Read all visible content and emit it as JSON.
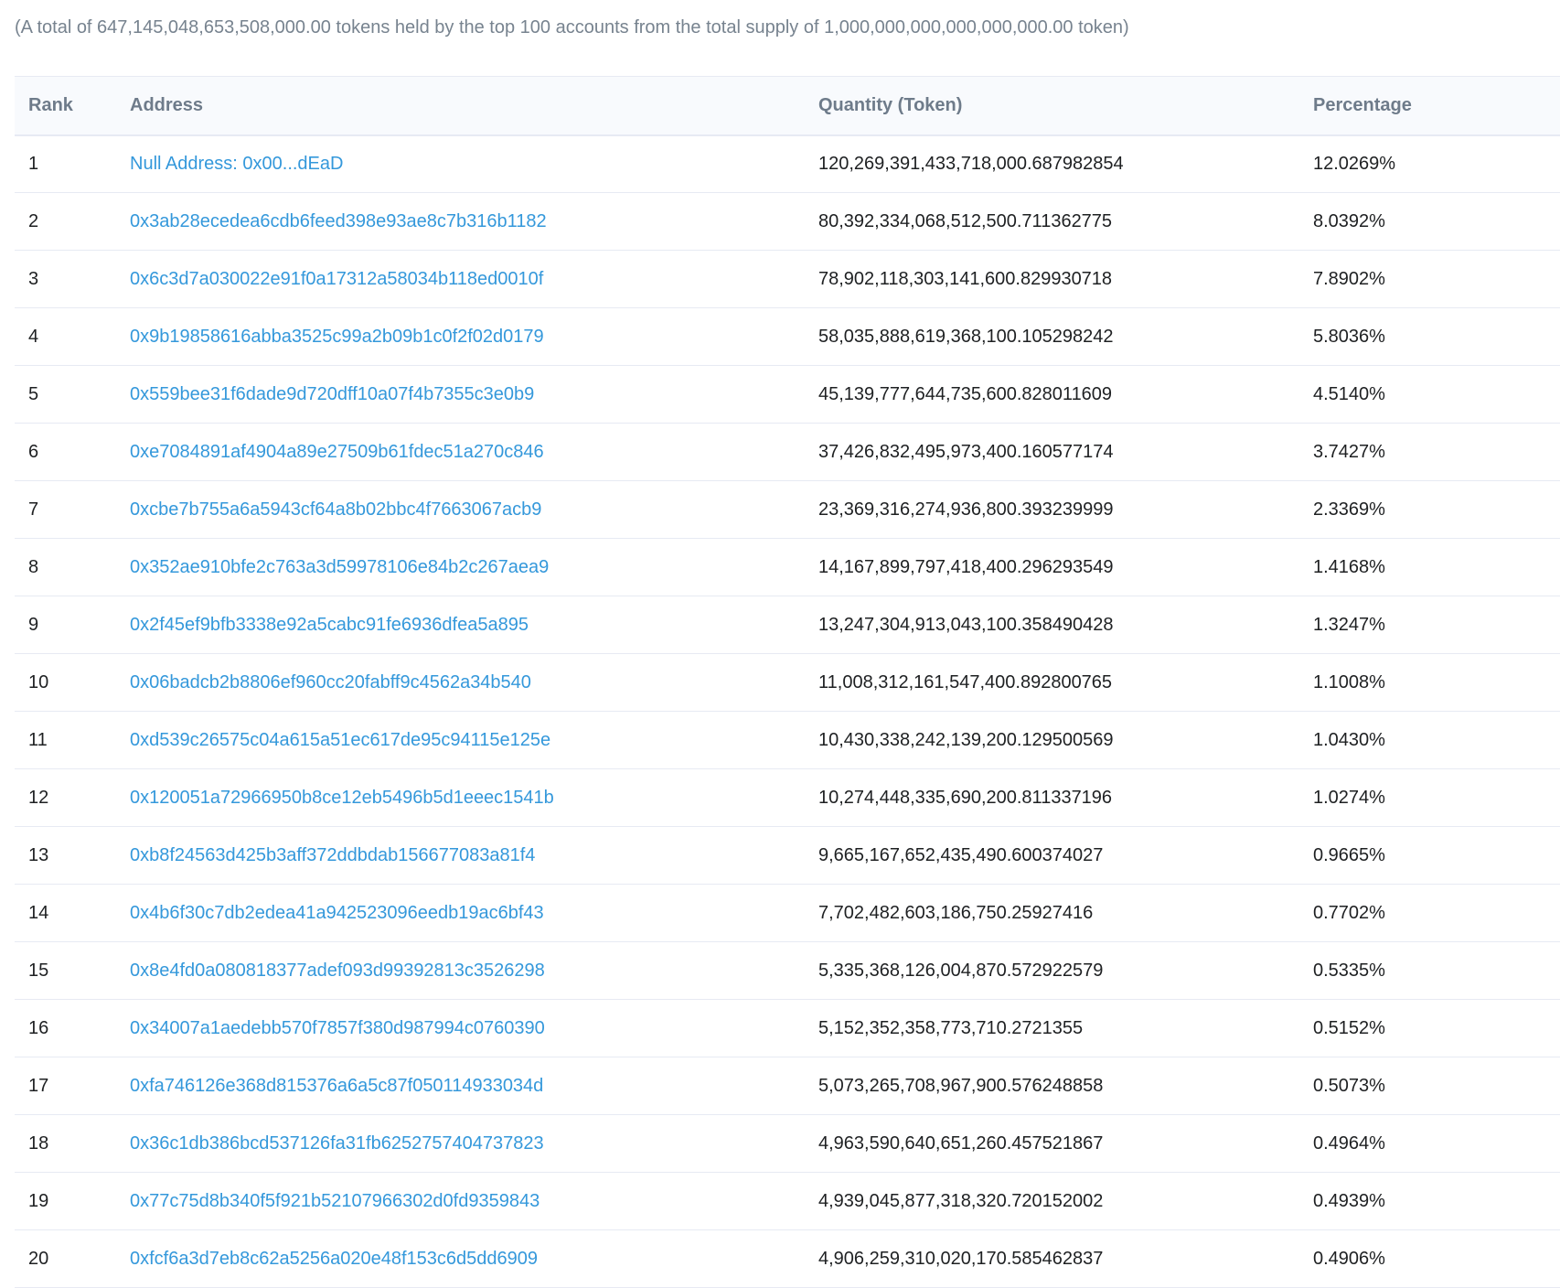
{
  "summary": "(A total of 647,145,048,653,508,000.00 tokens held by the top 100 accounts from the total supply of 1,000,000,000,000,000,000.00 token)",
  "table": {
    "headers": {
      "rank": "Rank",
      "address": "Address",
      "quantity": "Quantity (Token)",
      "percentage": "Percentage"
    },
    "rows": [
      {
        "rank": "1",
        "address": "Null Address: 0x00...dEaD",
        "quantity": "120,269,391,433,718,000.687982854",
        "percentage": "12.0269%"
      },
      {
        "rank": "2",
        "address": "0x3ab28ecedea6cdb6feed398e93ae8c7b316b1182",
        "quantity": "80,392,334,068,512,500.711362775",
        "percentage": "8.0392%"
      },
      {
        "rank": "3",
        "address": "0x6c3d7a030022e91f0a17312a58034b118ed0010f",
        "quantity": "78,902,118,303,141,600.829930718",
        "percentage": "7.8902%"
      },
      {
        "rank": "4",
        "address": "0x9b19858616abba3525c99a2b09b1c0f2f02d0179",
        "quantity": "58,035,888,619,368,100.105298242",
        "percentage": "5.8036%"
      },
      {
        "rank": "5",
        "address": "0x559bee31f6dade9d720dff10a07f4b7355c3e0b9",
        "quantity": "45,139,777,644,735,600.828011609",
        "percentage": "4.5140%"
      },
      {
        "rank": "6",
        "address": "0xe7084891af4904a89e27509b61fdec51a270c846",
        "quantity": "37,426,832,495,973,400.160577174",
        "percentage": "3.7427%"
      },
      {
        "rank": "7",
        "address": "0xcbe7b755a6a5943cf64a8b02bbc4f7663067acb9",
        "quantity": "23,369,316,274,936,800.393239999",
        "percentage": "2.3369%"
      },
      {
        "rank": "8",
        "address": "0x352ae910bfe2c763a3d59978106e84b2c267aea9",
        "quantity": "14,167,899,797,418,400.296293549",
        "percentage": "1.4168%"
      },
      {
        "rank": "9",
        "address": "0x2f45ef9bfb3338e92a5cabc91fe6936dfea5a895",
        "quantity": "13,247,304,913,043,100.358490428",
        "percentage": "1.3247%"
      },
      {
        "rank": "10",
        "address": "0x06badcb2b8806ef960cc20fabff9c4562a34b540",
        "quantity": "11,008,312,161,547,400.892800765",
        "percentage": "1.1008%"
      },
      {
        "rank": "11",
        "address": "0xd539c26575c04a615a51ec617de95c94115e125e",
        "quantity": "10,430,338,242,139,200.129500569",
        "percentage": "1.0430%"
      },
      {
        "rank": "12",
        "address": "0x120051a72966950b8ce12eb5496b5d1eeec1541b",
        "quantity": "10,274,448,335,690,200.811337196",
        "percentage": "1.0274%"
      },
      {
        "rank": "13",
        "address": "0xb8f24563d425b3aff372ddbdab156677083a81f4",
        "quantity": "9,665,167,652,435,490.600374027",
        "percentage": "0.9665%"
      },
      {
        "rank": "14",
        "address": "0x4b6f30c7db2edea41a942523096eedb19ac6bf43",
        "quantity": "7,702,482,603,186,750.25927416",
        "percentage": "0.7702%"
      },
      {
        "rank": "15",
        "address": "0x8e4fd0a080818377adef093d99392813c3526298",
        "quantity": "5,335,368,126,004,870.572922579",
        "percentage": "0.5335%"
      },
      {
        "rank": "16",
        "address": "0x34007a1aedebb570f7857f380d987994c0760390",
        "quantity": "5,152,352,358,773,710.2721355",
        "percentage": "0.5152%"
      },
      {
        "rank": "17",
        "address": "0xfa746126e368d815376a6a5c87f050114933034d",
        "quantity": "5,073,265,708,967,900.576248858",
        "percentage": "0.5073%"
      },
      {
        "rank": "18",
        "address": "0x36c1db386bcd537126fa31fb6252757404737823",
        "quantity": "4,963,590,640,651,260.457521867",
        "percentage": "0.4964%"
      },
      {
        "rank": "19",
        "address": "0x77c75d8b340f5f921b52107966302d0fd9359843",
        "quantity": "4,939,045,877,318,320.720152002",
        "percentage": "0.4939%"
      },
      {
        "rank": "20",
        "address": "0xfcf6a3d7eb8c62a5256a020e48f153c6d5dd6909",
        "quantity": "4,906,259,310,020,170.585462837",
        "percentage": "0.4906%"
      }
    ]
  },
  "colors": {
    "link": "#3498db",
    "muted_text": "#77838f",
    "border": "#e7eaf3",
    "header_bg": "#f8fafd"
  }
}
